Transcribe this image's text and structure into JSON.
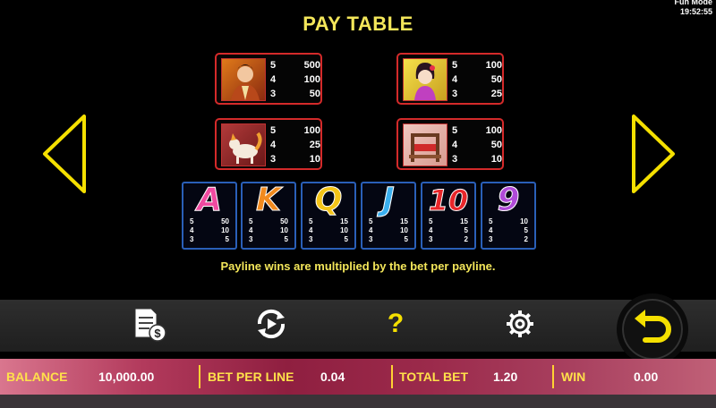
{
  "mode": {
    "line1": "Fun Mode",
    "line2": "19:52:55"
  },
  "title": "PAY TABLE",
  "symbols": [
    {
      "icon": "warrior-icon",
      "pays": [
        {
          "count": "5",
          "value": "500"
        },
        {
          "count": "4",
          "value": "100"
        },
        {
          "count": "3",
          "value": "50"
        }
      ]
    },
    {
      "icon": "lady-icon",
      "pays": [
        {
          "count": "5",
          "value": "100"
        },
        {
          "count": "4",
          "value": "50"
        },
        {
          "count": "3",
          "value": "25"
        }
      ]
    },
    {
      "icon": "fox-icon",
      "pays": [
        {
          "count": "5",
          "value": "100"
        },
        {
          "count": "4",
          "value": "25"
        },
        {
          "count": "3",
          "value": "10"
        }
      ]
    },
    {
      "icon": "loom-icon",
      "pays": [
        {
          "count": "5",
          "value": "100"
        },
        {
          "count": "4",
          "value": "50"
        },
        {
          "count": "3",
          "value": "10"
        }
      ]
    }
  ],
  "cards": [
    {
      "letter": "A",
      "color": "#f04aa0",
      "pays": [
        {
          "count": "5",
          "value": "50"
        },
        {
          "count": "4",
          "value": "10"
        },
        {
          "count": "3",
          "value": "5"
        }
      ]
    },
    {
      "letter": "K",
      "color": "#f28a1e",
      "pays": [
        {
          "count": "5",
          "value": "50"
        },
        {
          "count": "4",
          "value": "10"
        },
        {
          "count": "3",
          "value": "5"
        }
      ]
    },
    {
      "letter": "Q",
      "color": "#f5c518",
      "pays": [
        {
          "count": "5",
          "value": "15"
        },
        {
          "count": "4",
          "value": "10"
        },
        {
          "count": "3",
          "value": "5"
        }
      ]
    },
    {
      "letter": "J",
      "color": "#3ab0f0",
      "pays": [
        {
          "count": "5",
          "value": "15"
        },
        {
          "count": "4",
          "value": "10"
        },
        {
          "count": "3",
          "value": "5"
        }
      ]
    },
    {
      "letter": "10",
      "color": "#e8262a",
      "pays": [
        {
          "count": "5",
          "value": "15"
        },
        {
          "count": "4",
          "value": "5"
        },
        {
          "count": "3",
          "value": "2"
        }
      ]
    },
    {
      "letter": "9",
      "color": "#b04ad8",
      "pays": [
        {
          "count": "5",
          "value": "10"
        },
        {
          "count": "4",
          "value": "5"
        },
        {
          "count": "3",
          "value": "2"
        }
      ]
    }
  ],
  "note": "Payline wins are multiplied by the bet per payline.",
  "toolbar": [
    "paytable-cash-icon",
    "autoplay-icon",
    "help-icon",
    "settings-gear-icon",
    "back-return-icon"
  ],
  "status": {
    "balance_label": "BALANCE",
    "balance_value": "10,000.00",
    "bet_label": "BET PER LINE",
    "bet_value": "0.04",
    "total_label": "TOTAL BET",
    "total_value": "1.20",
    "win_label": "WIN",
    "win_value": "0.00"
  },
  "colors": {
    "accent": "#f3e65a",
    "card_border": "#d42a2a",
    "letter_border": "#2a5fb8"
  }
}
